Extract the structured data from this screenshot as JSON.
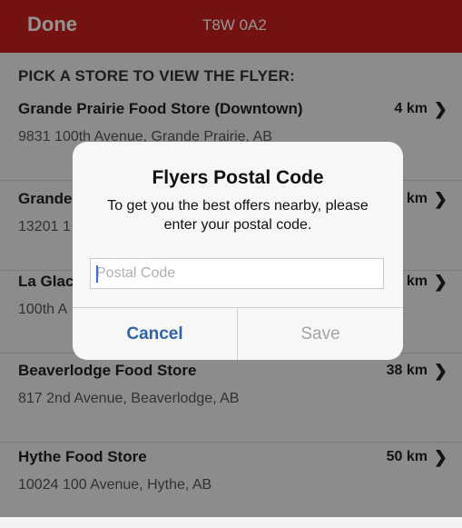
{
  "navbar": {
    "done_label": "Done",
    "title": "T8W 0A2"
  },
  "section_header": "PICK A STORE TO VIEW THE FLYER:",
  "stores": [
    {
      "name": "Grande Prairie Food Store (Downtown)",
      "address": "9831 100th Avenue, Grande Prairie, AB",
      "distance": "4 km"
    },
    {
      "name": "Grande",
      "address": "13201 1",
      "distance": "4 km"
    },
    {
      "name": "La Glac",
      "address": "100th A",
      "distance": "4 km"
    },
    {
      "name": "Beaverlodge Food Store",
      "address": "817 2nd Avenue, Beaverlodge, AB",
      "distance": "38 km"
    },
    {
      "name": "Hythe Food Store",
      "address": "10024 100 Avenue, Hythe, AB",
      "distance": "50 km"
    }
  ],
  "chevron": "❯",
  "dialog": {
    "title": "Flyers Postal Code",
    "message": "To get you the best offers nearby, please enter your postal code.",
    "input_value": "",
    "input_placeholder": "Postal Code",
    "cancel_label": "Cancel",
    "save_label": "Save"
  },
  "colors": {
    "navbar": "#c8201f",
    "button_blue": "#2f66a8"
  }
}
